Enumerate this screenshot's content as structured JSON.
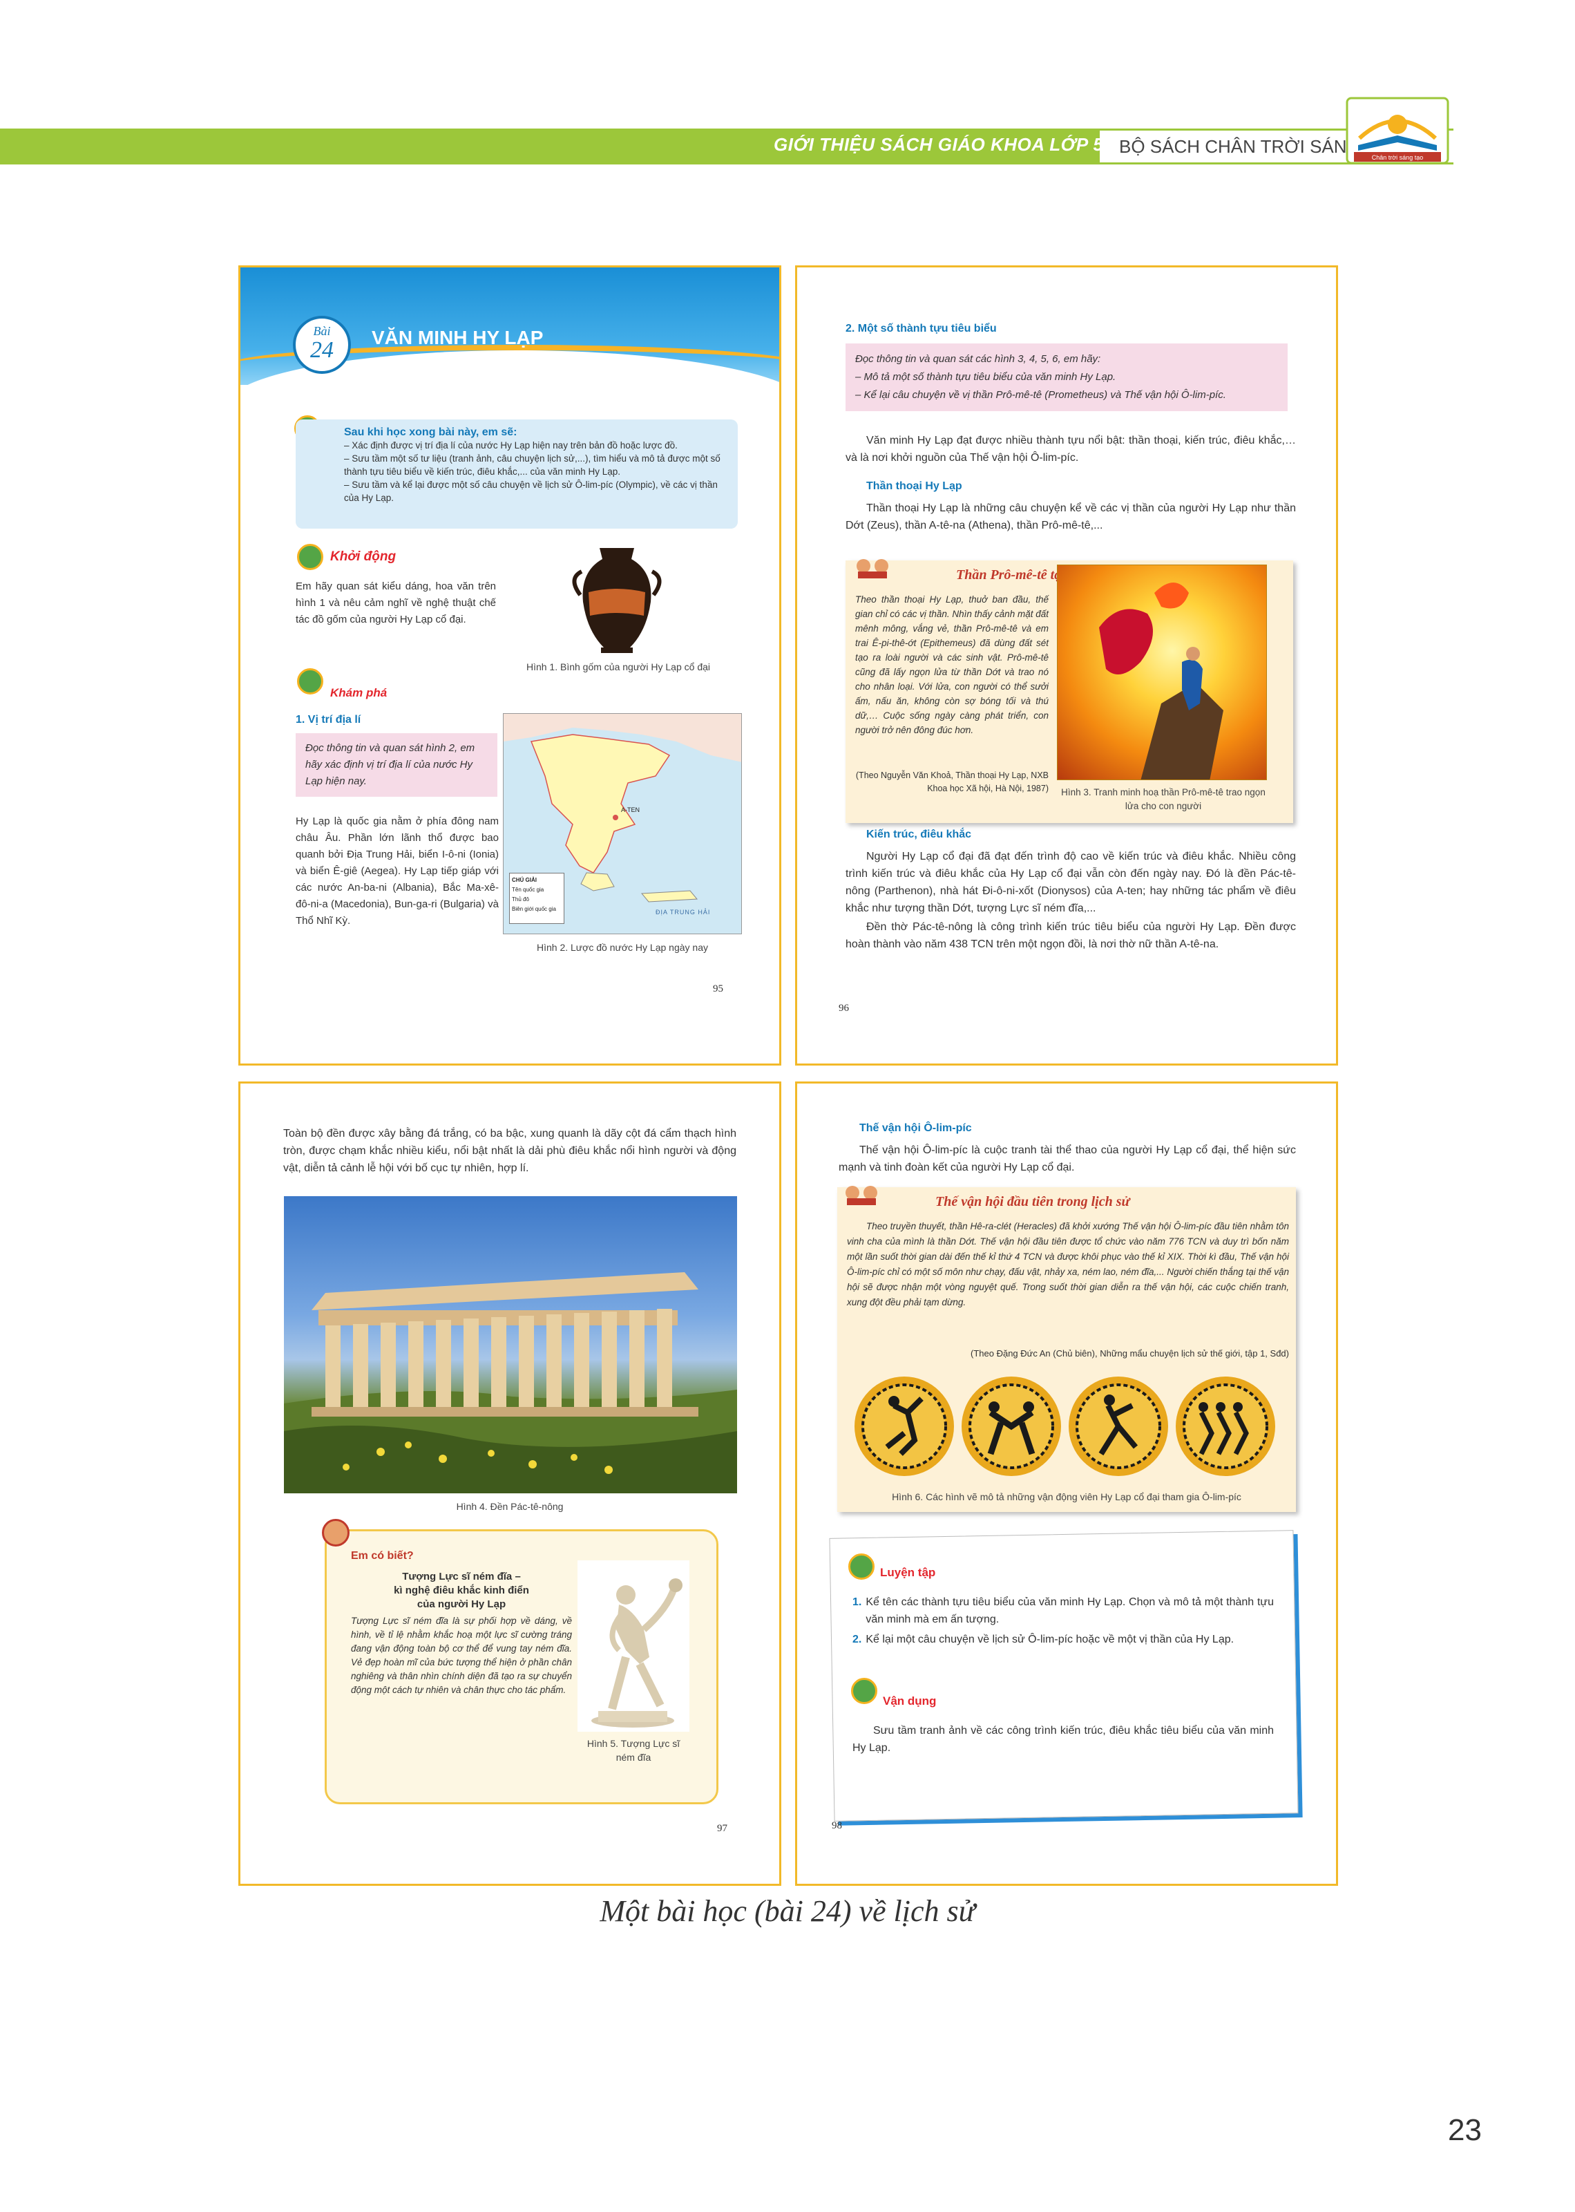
{
  "header": {
    "left_title": "GIỚI THIỆU SÁCH GIÁO KHOA LỚP 5",
    "right_title": "BỘ SÁCH CHÂN TRỜI SÁNG TẠO",
    "logo_text": "Chân trời sáng tạo"
  },
  "page95": {
    "lesson_label": "Bài",
    "lesson_number": "24",
    "lesson_title": "VĂN MINH HY LẠP",
    "goals": {
      "heading": "Sau khi học xong bài này, em sẽ:",
      "items": [
        "– Xác định được vị trí địa lí của nước Hy Lạp hiện nay trên bản đồ hoặc lược đồ.",
        "– Sưu tầm một số tư liệu (tranh ảnh, câu chuyện lịch sử,...), tìm hiểu và mô tả được một số thành tựu tiêu biểu về kiến trúc, điêu khắc,... của văn minh Hy Lạp.",
        "– Sưu tầm và kể lại được một số câu chuyện về lịch sử Ô-lim-píc (Olympic), về các vị thần của Hy Lạp."
      ]
    },
    "warmup_heading": "Khởi động",
    "warmup_text": "Em hãy quan sát kiểu dáng, hoa văn trên hình 1 và nêu cảm nghĩ về nghệ thuật chế tác đồ gốm của người Hy Lạp cổ đại.",
    "fig1_caption": "Hình 1. Bình gốm của người Hy Lạp cổ đại",
    "explore_heading": "Khám phá",
    "section1_title": "1. Vị trí địa lí",
    "section1_task": "Đọc thông tin và quan sát hình 2, em hãy xác định vị trí địa lí của nước Hy Lạp hiện nay.",
    "section1_text": "Hy Lạp là quốc gia nằm ở phía đông nam châu Âu. Phần lớn lãnh thổ được bao quanh bởi Địa Trung Hải, biển I-ô-ni (Ionia) và biển Ê-giê (Aegea). Hy Lạp tiếp giáp với các nước An-ba-ni (Albania), Bắc Ma-xê-đô-ni-a (Macedonia), Bun-ga-ri (Bulgaria) và Thổ Nhĩ Kỳ.",
    "fig2_caption": "Hình 2. Lược đồ nước Hy Lạp ngày nay",
    "map_legend_title": "CHÚ GIẢI",
    "map_legend_items": [
      "Tên quốc gia",
      "Thủ đô",
      "Biên giới quốc gia"
    ],
    "map_capital": "A-TEN",
    "map_sea": "ĐỊA TRUNG HẢI",
    "page_number": "95"
  },
  "page96": {
    "section2_title": "2. Một số thành tựu tiêu biểu",
    "task_lines": [
      "Đọc thông tin và quan sát các hình 3, 4, 5, 6, em hãy:",
      "– Mô tả một số thành tựu tiêu biểu của văn minh Hy Lạp.",
      "– Kể lại câu chuyện về vị thần Prô-mê-tê (Prometheus) và Thế vận hội Ô-lim-píc."
    ],
    "intro_text": "Văn minh Hy Lạp đạt được nhiều thành tựu nổi bật: thần thoại, kiến trúc, điêu khắc,… và là nơi khởi nguồn của Thế vận hội Ô-lim-píc.",
    "myth_heading": "Thần thoại Hy Lạp",
    "myth_text": "Thần thoại Hy Lạp là những câu chuyện kể về các vị thần của người Hy Lạp như thần Dớt (Zeus), thần A-tê-na (Athena), thần Prô-mê-tê,...",
    "story_title": "Thần Prô-mê-tê tạo ra loài người",
    "story_text": "Theo thần thoại Hy Lạp, thuở ban đầu, thế gian chỉ có các vị thần. Nhìn thấy cảnh mặt đất mênh mông, vắng vẻ, thần Prô-mê-tê và em trai Ê-pi-thê-ớt (Epithemeus) đã dùng đất sét tạo ra loài người và các sinh vật. Prô-mê-tê cũng đã lấy ngọn lửa từ thần Dớt và trao nó cho nhân loại. Với lửa, con người có thể sưởi ấm, nấu ăn, không còn sợ bóng tối và thú dữ,… Cuộc sống ngày càng phát triển, con người trở nên đông đúc hơn.",
    "story_source": "(Theo Nguyễn Văn Khoả, Thần thoại Hy Lạp, NXB Khoa học Xã hội, Hà Nội, 1987)",
    "fig3_caption": "Hình 3. Tranh minh hoạ thần Prô-mê-tê trao ngọn lửa cho con người",
    "arch_heading": "Kiến trúc, điêu khắc",
    "arch_text1": "Người Hy Lạp cổ đại đã đạt đến trình độ cao về kiến trúc và điêu khắc. Nhiều công trình kiến trúc và điêu khắc của Hy Lạp cổ đại vẫn còn đến ngày nay. Đó là đền Pác-tê-nông (Parthenon), nhà hát Đi-ô-ni-xốt (Dionysos) của A-ten; hay những tác phẩm về điêu khắc như tượng thần Dớt, tượng Lực sĩ ném đĩa,...",
    "arch_text2": "Đền thờ Pác-tê-nông là công trình kiến trúc tiêu biểu của người Hy Lạp. Đền được hoàn thành vào năm 438 TCN trên một ngọn đồi, là nơi thờ nữ thần A-tê-na.",
    "page_number": "96"
  },
  "page97": {
    "intro_text": "Toàn bộ đền được xây bằng đá trắng, có ba bậc, xung quanh là dãy cột đá cẩm thạch hình tròn, được chạm khắc nhiều kiểu, nổi bật nhất là dải phù điêu khắc nổi hình người và động vật, diễn tả cảnh lễ hội với bố cục tự nhiên, hợp lí.",
    "fig4_caption": "Hình 4. Đền Pác-tê-nông",
    "know_heading": "Em có biết?",
    "know_title_lines": [
      "Tượng Lực sĩ ném đĩa –",
      "kì nghệ điêu khắc kinh điển",
      "của người Hy Lạp"
    ],
    "know_text": "Tượng Lực sĩ ném đĩa là sự phối hợp về dáng, về hình, về tỉ lệ nhằm khắc hoạ một lực sĩ cường tráng đang vận động toàn bộ cơ thể để vung tay ném đĩa. Vẻ đẹp hoàn mĩ của bức tượng thể hiện ở phần chân nghiêng và thân nhìn chính diện đã tạo ra sự chuyển động một cách tự nhiên và chân thực cho tác phẩm.",
    "fig5_caption_lines": [
      "Hình 5. Tượng Lực sĩ",
      "ném đĩa"
    ],
    "page_number": "97"
  },
  "page98": {
    "olympic_heading": "Thế vận hội Ô-lim-píc",
    "olympic_text": "Thế vận hội Ô-lim-píc là cuộc tranh tài thể thao của người Hy Lạp cổ đại, thể hiện sức mạnh và tinh đoàn kết của người Hy Lạp cổ đại.",
    "story_title": "Thế vận hội đầu tiên trong lịch sử",
    "story_text": "Theo truyền thuyết, thần Hê-ra-clét (Heracles) đã khởi xướng Thế vận hội Ô-lim-píc đầu tiên nhằm tôn vinh cha của mình là thần Dớt. Thế vận hội đầu tiên được tổ chức vào năm 776 TCN và duy trì bốn năm một lần suốt thời gian dài đến thế kỉ thứ 4 TCN và được khôi phục vào thế kỉ XIX. Thời kì đầu, Thế vận hội Ô-lim-píc chỉ có một số môn như chạy, đấu vật, nhảy xa, ném lao, ném đĩa,... Người chiến thắng tại thế vận hội sẽ được nhận một vòng nguyệt quế. Trong suốt thời gian diễn ra thế vận hội, các cuộc chiến tranh, xung đột đều phải tạm dừng.",
    "story_source": "(Theo Đặng Đức An (Chủ biên), Những mẩu chuyện lịch sử thế giới, tập 1, Sđd)",
    "fig6_caption": "Hình 6. Các hình vẽ mô tả những vận động viên Hy Lạp cổ đại tham gia Ô-lim-píc",
    "practice_heading": "Luyện tập",
    "practice_items": [
      "Kể tên các thành tựu tiêu biểu của văn minh Hy Lạp. Chọn và mô tả một thành tựu văn minh mà em ấn tượng.",
      "Kể lại một câu chuyện về lịch sử Ô-lim-píc hoặc về một vị thần của Hy Lạp."
    ],
    "practice_numbers": [
      "1.",
      "2."
    ],
    "apply_heading": "Vận dụng",
    "apply_text": "Sưu tầm tranh ảnh về các công trình kiến trúc, điêu khắc tiêu biểu của văn minh Hy Lạp.",
    "page_number": "98"
  },
  "caption": "Một bài học (bài 24) về lịch sử",
  "page_number": "23",
  "colors": {
    "header_green": "#9cc73a",
    "frame_yellow": "#f2b929",
    "section_blue": "#1479b8",
    "heading_red": "#e3262d",
    "task_pink": "#f6dbe7"
  }
}
